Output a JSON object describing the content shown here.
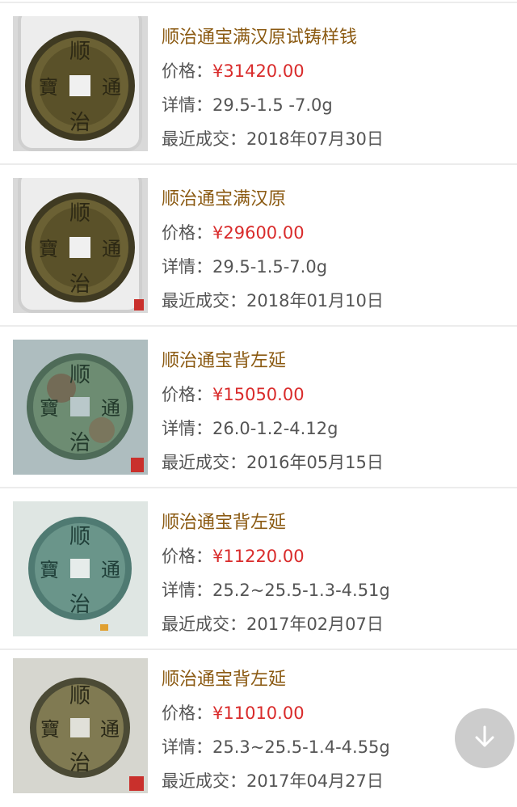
{
  "items": [
    {
      "title": "顺治通宝满汉原试铸样钱",
      "price_label": "价格：",
      "price": "¥31420.00",
      "detail_label": "详情：",
      "detail": "29.5-1.5 -7.0g",
      "date_label": "最近成交：",
      "date": "2018年07月30日"
    },
    {
      "title": "顺治通宝满汉原",
      "price_label": "价格：",
      "price": "¥29600.00",
      "detail_label": "详情：",
      "detail": "29.5-1.5-7.0g",
      "date_label": "最近成交：",
      "date": "2018年01月10日"
    },
    {
      "title": "顺治通宝背左延",
      "price_label": "价格：",
      "price": "¥15050.00",
      "detail_label": "详情：",
      "detail": "26.0-1.2-4.12g",
      "date_label": "最近成交：",
      "date": "2016年05月15日"
    },
    {
      "title": "顺治通宝背左延",
      "price_label": "价格：",
      "price": "¥11220.00",
      "detail_label": "详情：",
      "detail": "25.2~25.5-1.3-4.51g",
      "date_label": "最近成交：",
      "date": "2017年02月07日"
    },
    {
      "title": "顺治通宝背左延",
      "price_label": "价格：",
      "price": "¥11010.00",
      "detail_label": "详情：",
      "detail": "25.3~25.5-1.4-4.55g",
      "date_label": "最近成交：",
      "date": "2017年04月27日"
    }
  ],
  "scroll_button": {
    "icon": "arrow-down-icon"
  },
  "colors": {
    "title": "#8b5a12",
    "price": "#d92b2b",
    "text": "#555555"
  }
}
